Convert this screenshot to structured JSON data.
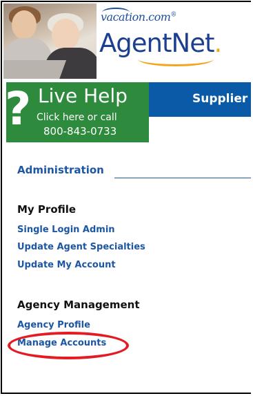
{
  "header": {
    "brand_small": "vacation.com",
    "brand_small_mark": "®",
    "brand_main_part1": "Agent",
    "brand_main_part2": "Net",
    "brand_main_dot": "."
  },
  "nav": {
    "suppliers_label": "Supplier",
    "live_help": {
      "icon_glyph": "?",
      "title": "Live Help",
      "line1": "Click here or call",
      "line2": "800-843-0733"
    }
  },
  "content": {
    "administration_heading": "Administration",
    "my_profile": {
      "heading": "My Profile",
      "links": [
        "Single Login Admin",
        "Update Agent Specialties",
        "Update My Account"
      ]
    },
    "agency_management": {
      "heading": "Agency Management",
      "links": [
        "Agency Profile",
        "Manage Accounts"
      ]
    }
  },
  "colors": {
    "link_blue": "#1c56a4",
    "nav_blue": "#0a5aa8",
    "live_help_green": "#2e8a3c",
    "highlight_red": "#e41b23",
    "brand_orange": "#f2a51a"
  }
}
